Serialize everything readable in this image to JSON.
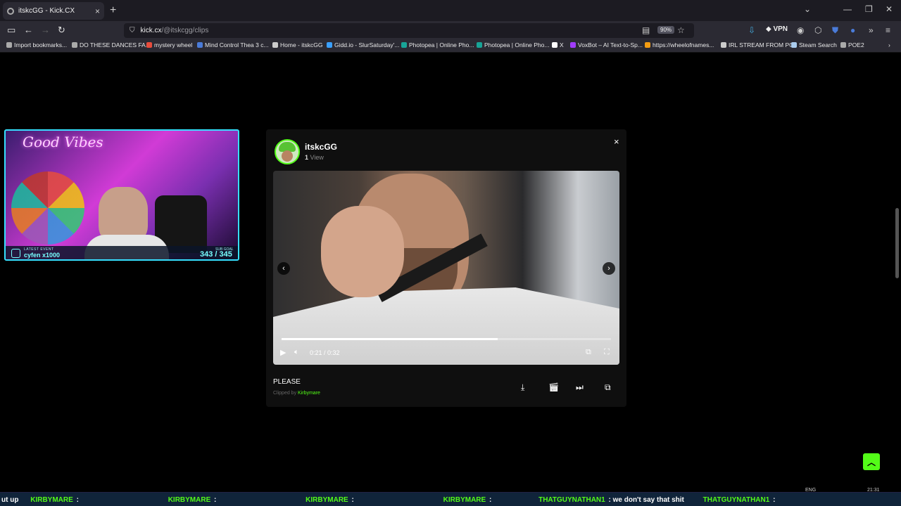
{
  "browser": {
    "tab_title": "itskcGG - Kick.CX",
    "tab_close": "×",
    "new_tab": "+",
    "url_host": "kick.cx",
    "url_path": "/@itskcgg/clips",
    "zoom": "90%",
    "vpn_label": "VPN"
  },
  "bookmarks": [
    {
      "label": "Import bookmarks...",
      "color": "#aaaaaa"
    },
    {
      "label": "DO THESE DANCES FA...",
      "color": "#aaaaaa"
    },
    {
      "label": "mystery wheel",
      "color": "#e74c3c"
    },
    {
      "label": "Mind Control Thea 3 c...",
      "color": "#4a7bd8"
    },
    {
      "label": "Home - itskcGG",
      "color": "#cccccc"
    },
    {
      "label": "Gidd.io - SlurSaturday'...",
      "color": "#3aa0ff"
    },
    {
      "label": "Photopea | Online Pho...",
      "color": "#18a497"
    },
    {
      "label": "Photopea | Online Pho...",
      "color": "#18a497"
    },
    {
      "label": "X",
      "color": "#ffffff"
    },
    {
      "label": "VoxBot – AI Text-to-Sp...",
      "color": "#a13cff"
    },
    {
      "label": "https://wheelofnames...",
      "color": "#f39c12"
    },
    {
      "label": "IRL STREAM FROM PC",
      "color": "#cccccc"
    },
    {
      "label": "Steam Search",
      "color": "#aaccee"
    },
    {
      "label": "POE2",
      "color": "#aaaaaa"
    }
  ],
  "webcam": {
    "neon_text": "Good Vibes",
    "latest_event_label": "LATEST EVENT",
    "latest_event_value": "cyfen x1000",
    "sub_goal_label": "SUB GOAL",
    "sub_goal_value": "343 / 345"
  },
  "clip": {
    "username": "itskcGG",
    "view_count": "1",
    "view_label": "View",
    "close": "×",
    "current_time": "0:21",
    "duration": "0:32",
    "progress": 0.656,
    "title": "PLEASE",
    "clipped_by_label": "Clipped by",
    "clipped_by_user": "Kirbymare"
  },
  "ticker": [
    {
      "name": "",
      "text": "ut up"
    },
    {
      "name": "KIRBYMARE",
      "text": ":"
    },
    {
      "name": "KIRBYMARE",
      "text": ":"
    },
    {
      "name": "KIRBYMARE",
      "text": ":"
    },
    {
      "name": "KIRBYMARE",
      "text": ":"
    },
    {
      "name": "THATGUYNATHAN1",
      "text": ": we don't say that shit"
    },
    {
      "name": "THATGUYNATHAN1",
      "text": ":"
    }
  ],
  "tray": {
    "lang": "ENG",
    "time": "21:31"
  }
}
